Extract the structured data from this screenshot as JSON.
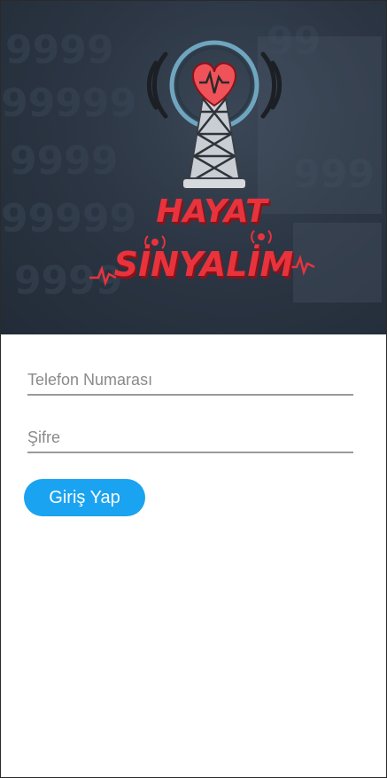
{
  "logo": {
    "line1": "HAYAT",
    "line2": "SİNYALİM",
    "text_color": "#e8333d",
    "shadow_color": "#8c1218"
  },
  "form": {
    "phone_placeholder": "Telefon Numarası",
    "phone_value": "",
    "password_placeholder": "Şifre",
    "password_value": "",
    "login_label": "Giriş Yap"
  },
  "colors": {
    "accent": "#1aa3f0",
    "hero_background": "#2c3644",
    "underline": "#9a9a9a"
  }
}
